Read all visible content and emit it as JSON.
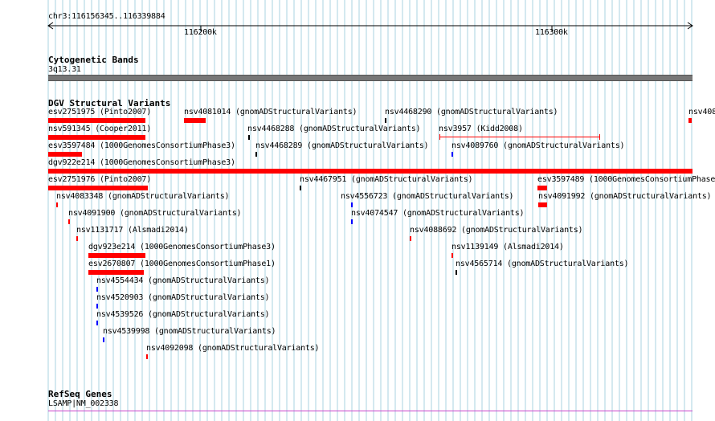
{
  "ruler": {
    "location": "chr3:116156345..116339884",
    "ticks": [
      "116200k",
      "116300k"
    ]
  },
  "tracks": {
    "cytoband": {
      "title": "Cytogenetic Bands",
      "band": "3q13.31"
    },
    "dgv": {
      "title": "DGV Structural Variants",
      "features": [
        {
          "id": "f01",
          "label": "esv2751975 (Pinto2007)",
          "color": "#ff0000",
          "kind": "bar"
        },
        {
          "id": "f02",
          "label": "nsv4081014 (gnomADStructuralVariants)",
          "color": "#ff0000",
          "kind": "bar"
        },
        {
          "id": "f03",
          "label": "nsv4468290 (gnomADStructuralVariants)",
          "color": "#000000",
          "kind": "tick"
        },
        {
          "id": "f04",
          "label": "nsv408",
          "color": "#ff0000",
          "kind": "tick"
        },
        {
          "id": "f05",
          "label": "nsv591345 (Cooper2011)",
          "color": "#ff0000",
          "kind": "bar"
        },
        {
          "id": "f06",
          "label": "nsv4468288 (gnomADStructuralVariants)",
          "color": "#000000",
          "kind": "tick"
        },
        {
          "id": "f07",
          "label": "nsv3957 (Kidd2008)",
          "color": "#ff0000",
          "kind": "line"
        },
        {
          "id": "f08",
          "label": "esv3597484 (1000GenomesConsortiumPhase3)",
          "color": "#ff0000",
          "kind": "bar"
        },
        {
          "id": "f09",
          "label": "nsv4468289 (gnomADStructuralVariants)",
          "color": "#000000",
          "kind": "tick"
        },
        {
          "id": "f10",
          "label": "nsv4089760 (gnomADStructuralVariants)",
          "color": "#0000ff",
          "kind": "tick"
        },
        {
          "id": "f11",
          "label": "dgv922e214 (1000GenomesConsortiumPhase3)",
          "color": "#ff0000",
          "kind": "bar"
        },
        {
          "id": "f12",
          "label": "esv2751976 (Pinto2007)",
          "color": "#ff0000",
          "kind": "bar"
        },
        {
          "id": "f13",
          "label": "nsv4467951 (gnomADStructuralVariants)",
          "color": "#000000",
          "kind": "tick"
        },
        {
          "id": "f14",
          "label": "esv3597489 (1000GenomesConsortiumPhase",
          "color": "#ff0000",
          "kind": "bar"
        },
        {
          "id": "f15",
          "label": "nsv4083348 (gnomADStructuralVariants)",
          "color": "#ff0000",
          "kind": "tick"
        },
        {
          "id": "f16",
          "label": "nsv4556723 (gnomADStructuralVariants)",
          "color": "#0000ff",
          "kind": "tick"
        },
        {
          "id": "f17",
          "label": "nsv4091992 (gnomADStructuralVariants)",
          "color": "#ff0000",
          "kind": "bar"
        },
        {
          "id": "f18",
          "label": "nsv4091900 (gnomADStructuralVariants)",
          "color": "#ff0000",
          "kind": "tick"
        },
        {
          "id": "f19",
          "label": "nsv4074547 (gnomADStructuralVariants)",
          "color": "#0000ff",
          "kind": "tick"
        },
        {
          "id": "f20",
          "label": "nsv1131717 (Alsmadi2014)",
          "color": "#ff0000",
          "kind": "tick"
        },
        {
          "id": "f21",
          "label": "nsv4088692 (gnomADStructuralVariants)",
          "color": "#ff0000",
          "kind": "tick"
        },
        {
          "id": "f22",
          "label": "dgv923e214 (1000GenomesConsortiumPhase3)",
          "color": "#ff0000",
          "kind": "bar"
        },
        {
          "id": "f23",
          "label": "nsv1139149 (Alsmadi2014)",
          "color": "#ff0000",
          "kind": "tick"
        },
        {
          "id": "f24",
          "label": "esv2670807 (1000GenomesConsortiumPhase1)",
          "color": "#ff0000",
          "kind": "bar"
        },
        {
          "id": "f25",
          "label": "nsv4565714 (gnomADStructuralVariants)",
          "color": "#000000",
          "kind": "tick"
        },
        {
          "id": "f26",
          "label": "nsv4554434 (gnomADStructuralVariants)",
          "color": "#0000ff",
          "kind": "tick"
        },
        {
          "id": "f27",
          "label": "nsv4520903 (gnomADStructuralVariants)",
          "color": "#0000ff",
          "kind": "tick"
        },
        {
          "id": "f28",
          "label": "nsv4539526 (gnomADStructuralVariants)",
          "color": "#0000ff",
          "kind": "tick"
        },
        {
          "id": "f29",
          "label": "nsv4539998 (gnomADStructuralVariants)",
          "color": "#0000ff",
          "kind": "tick"
        },
        {
          "id": "f30",
          "label": "nsv4092098 (gnomADStructuralVariants)",
          "color": "#ff0000",
          "kind": "tick"
        }
      ]
    },
    "refseq": {
      "title": "RefSeq Genes",
      "gene": "LSAMP|NM_002338",
      "color": "#cc44cc"
    }
  },
  "colors": {
    "grid": "#a9d3e0",
    "cytoband": "#777777"
  }
}
